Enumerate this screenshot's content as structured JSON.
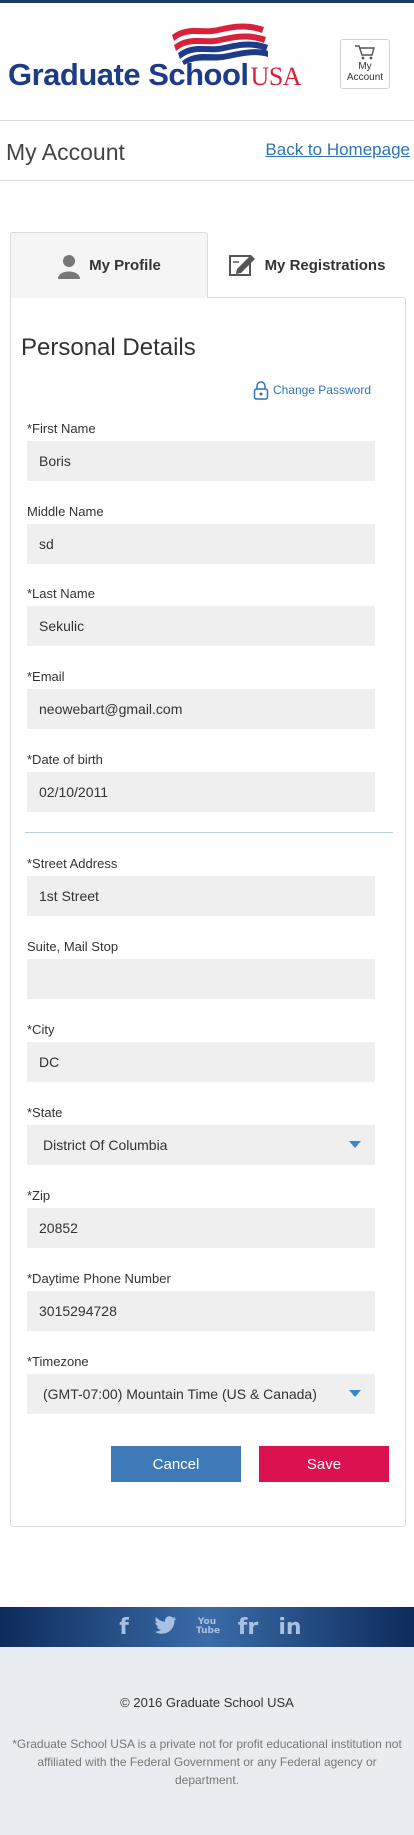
{
  "header": {
    "brand": "Graduate School",
    "brand_suffix": "USA",
    "cart_label_line1": "My",
    "cart_label_line2": "Account"
  },
  "account_bar": {
    "title": "My Account",
    "back_link": "Back to Homepage"
  },
  "tabs": [
    {
      "label": "My Profile",
      "active": true,
      "icon": "person-icon"
    },
    {
      "label": "My Registrations",
      "active": false,
      "icon": "edit-document-icon"
    }
  ],
  "form": {
    "title": "Personal Details",
    "change_password": "Change Password",
    "fields": {
      "first_name": {
        "label": "*First Name",
        "value": "Boris"
      },
      "middle_name": {
        "label": "Middle Name",
        "value": "sd"
      },
      "last_name": {
        "label": "*Last Name",
        "value": "Sekulic"
      },
      "email": {
        "label": "*Email",
        "value": "neowebart@gmail.com"
      },
      "dob": {
        "label": "*Date of birth",
        "value": "02/10/2011"
      },
      "street": {
        "label": "*Street Address",
        "value": "1st Street"
      },
      "suite": {
        "label": "Suite, Mail Stop",
        "value": ""
      },
      "city": {
        "label": "*City",
        "value": "DC"
      },
      "state": {
        "label": "*State",
        "value": "District Of Columbia"
      },
      "zip": {
        "label": "*Zip",
        "value": "20852"
      },
      "phone": {
        "label": "*Daytime Phone Number",
        "value": "3015294728"
      },
      "timezone": {
        "label": "*Timezone",
        "value": "(GMT-07:00) Mountain Time (US & Canada)"
      }
    },
    "cancel_label": "Cancel",
    "save_label": "Save"
  },
  "social_icons": [
    "facebook-icon",
    "twitter-icon",
    "youtube-icon",
    "flickr-icon",
    "linkedin-icon"
  ],
  "social": {
    "facebook": "f",
    "twitter": "🐦",
    "youtube": "You Tube",
    "flickr": "fr",
    "linkedin": "in"
  },
  "footer": {
    "copyright": "© 2016 Graduate School USA",
    "disclaimer": "*Graduate School USA is a private not for profit educational institution not affiliated with the Federal Government or any Federal agency or department."
  },
  "colors": {
    "brand_blue": "#1d3b86",
    "brand_red": "#d8213b",
    "link": "#2e74b5",
    "cancel": "#3f7ab8",
    "save": "#dc1250"
  }
}
